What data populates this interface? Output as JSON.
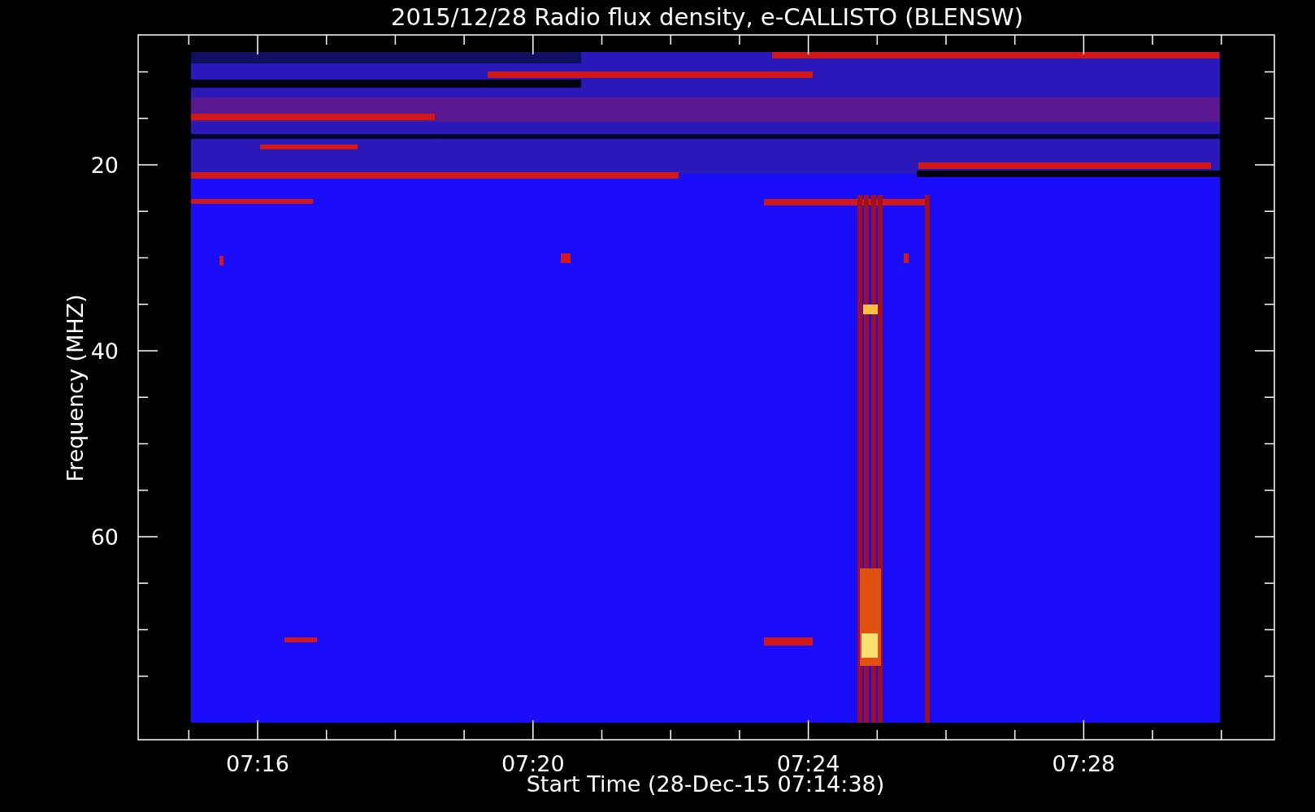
{
  "title": "2015/12/28  Radio flux density, e-CALLISTO (BLENSW)",
  "ylabel": "Frequency (MHZ)",
  "xlabel": "Start Time (28-Dec-15 07:14:38)",
  "yticks": [
    "20",
    "40",
    "60"
  ],
  "xticks": [
    "07:16",
    "07:20",
    "07:24",
    "07:28"
  ]
}
